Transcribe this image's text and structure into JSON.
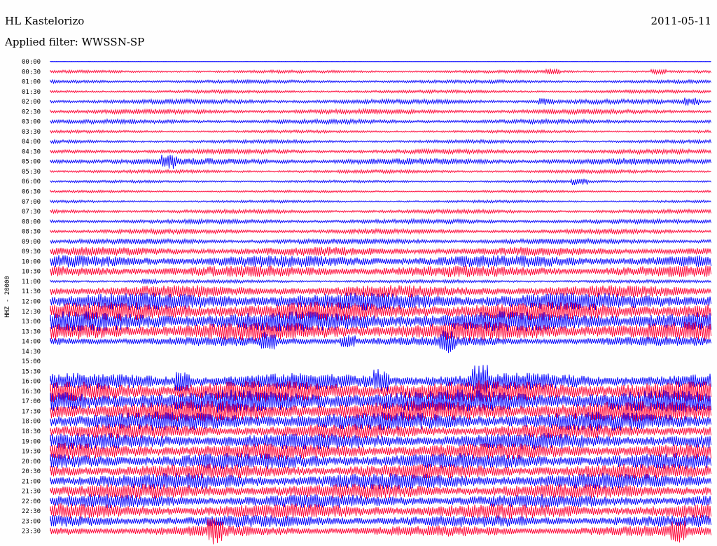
{
  "header": {
    "station": "HL Kastelorizo",
    "date": "2011-05-11",
    "filter": "Applied filter: WWSSN-SP"
  },
  "channel": "HHZ - 20000",
  "colors": {
    "even": "#0000ff",
    "odd": "#ff0033",
    "background": "#fefefe",
    "text": "#000000"
  },
  "chart_data": {
    "type": "line",
    "title": "HL Kastelorizo",
    "subtitle": "Applied filter: WWSSN-SP",
    "ylabel": "HHZ - 20000",
    "xlabel": "",
    "grid": false,
    "rows": [
      {
        "label": "00:00",
        "amp": 0.3,
        "spikes": []
      },
      {
        "label": "00:30",
        "amp": 2.2,
        "spikes": [
          0.76,
          0.92
        ]
      },
      {
        "label": "01:00",
        "amp": 2.6,
        "spikes": []
      },
      {
        "label": "01:30",
        "amp": 2.4,
        "spikes": []
      },
      {
        "label": "02:00",
        "amp": 3.6,
        "spikes": [
          0.75,
          0.97
        ]
      },
      {
        "label": "02:30",
        "amp": 3.6,
        "spikes": []
      },
      {
        "label": "03:00",
        "amp": 3.4,
        "spikes": []
      },
      {
        "label": "03:30",
        "amp": 2.2,
        "spikes": []
      },
      {
        "label": "04:00",
        "amp": 2.6,
        "spikes": []
      },
      {
        "label": "04:30",
        "amp": 3.5,
        "spikes": []
      },
      {
        "label": "05:00",
        "amp": 4.8,
        "spikes": [
          0.18
        ]
      },
      {
        "label": "05:30",
        "amp": 2.6,
        "spikes": []
      },
      {
        "label": "06:00",
        "amp": 2.0,
        "spikes": [
          0.8
        ]
      },
      {
        "label": "06:30",
        "amp": 1.8,
        "spikes": []
      },
      {
        "label": "07:00",
        "amp": 2.0,
        "spikes": []
      },
      {
        "label": "07:30",
        "amp": 3.0,
        "spikes": []
      },
      {
        "label": "08:00",
        "amp": 3.4,
        "spikes": []
      },
      {
        "label": "08:30",
        "amp": 3.6,
        "spikes": []
      },
      {
        "label": "09:00",
        "amp": 4.2,
        "spikes": []
      },
      {
        "label": "09:30",
        "amp": 6.5,
        "spikes": []
      },
      {
        "label": "10:00",
        "amp": 9.0,
        "spikes": []
      },
      {
        "label": "10:30",
        "amp": 8.5,
        "spikes": []
      },
      {
        "label": "11:00",
        "amp": 2.5,
        "spikes": [
          0.15
        ]
      },
      {
        "label": "11:30",
        "amp": 9.0,
        "spikes": []
      },
      {
        "label": "12:00",
        "amp": 13.0,
        "spikes": []
      },
      {
        "label": "12:30",
        "amp": 14.0,
        "spikes": []
      },
      {
        "label": "13:00",
        "amp": 15.0,
        "spikes": []
      },
      {
        "label": "13:30",
        "amp": 14.0,
        "spikes": []
      },
      {
        "label": "14:00",
        "amp": 7.0,
        "spikes": [
          0.33,
          0.45,
          0.6
        ]
      },
      {
        "label": "14:30",
        "amp": 0,
        "spikes": []
      },
      {
        "label": "15:00",
        "amp": 0,
        "spikes": []
      },
      {
        "label": "15:30",
        "amp": 0,
        "spikes": []
      },
      {
        "label": "16:00",
        "amp": 12.0,
        "spikes": [
          0.2,
          0.5,
          0.65
        ]
      },
      {
        "label": "16:30",
        "amp": 16.0,
        "spikes": []
      },
      {
        "label": "17:00",
        "amp": 17.0,
        "spikes": []
      },
      {
        "label": "17:30",
        "amp": 16.0,
        "spikes": []
      },
      {
        "label": "18:00",
        "amp": 14.0,
        "spikes": []
      },
      {
        "label": "18:30",
        "amp": 11.0,
        "spikes": []
      },
      {
        "label": "19:00",
        "amp": 12.0,
        "spikes": []
      },
      {
        "label": "19:30",
        "amp": 12.0,
        "spikes": []
      },
      {
        "label": "20:00",
        "amp": 12.0,
        "spikes": []
      },
      {
        "label": "20:30",
        "amp": 11.0,
        "spikes": []
      },
      {
        "label": "21:00",
        "amp": 12.0,
        "spikes": []
      },
      {
        "label": "21:30",
        "amp": 11.0,
        "spikes": []
      },
      {
        "label": "22:00",
        "amp": 10.0,
        "spikes": []
      },
      {
        "label": "22:30",
        "amp": 11.0,
        "spikes": []
      },
      {
        "label": "23:00",
        "amp": 9.0,
        "spikes": []
      },
      {
        "label": "23:30",
        "amp": 8.0,
        "spikes": [
          0.25,
          0.95
        ]
      }
    ]
  }
}
